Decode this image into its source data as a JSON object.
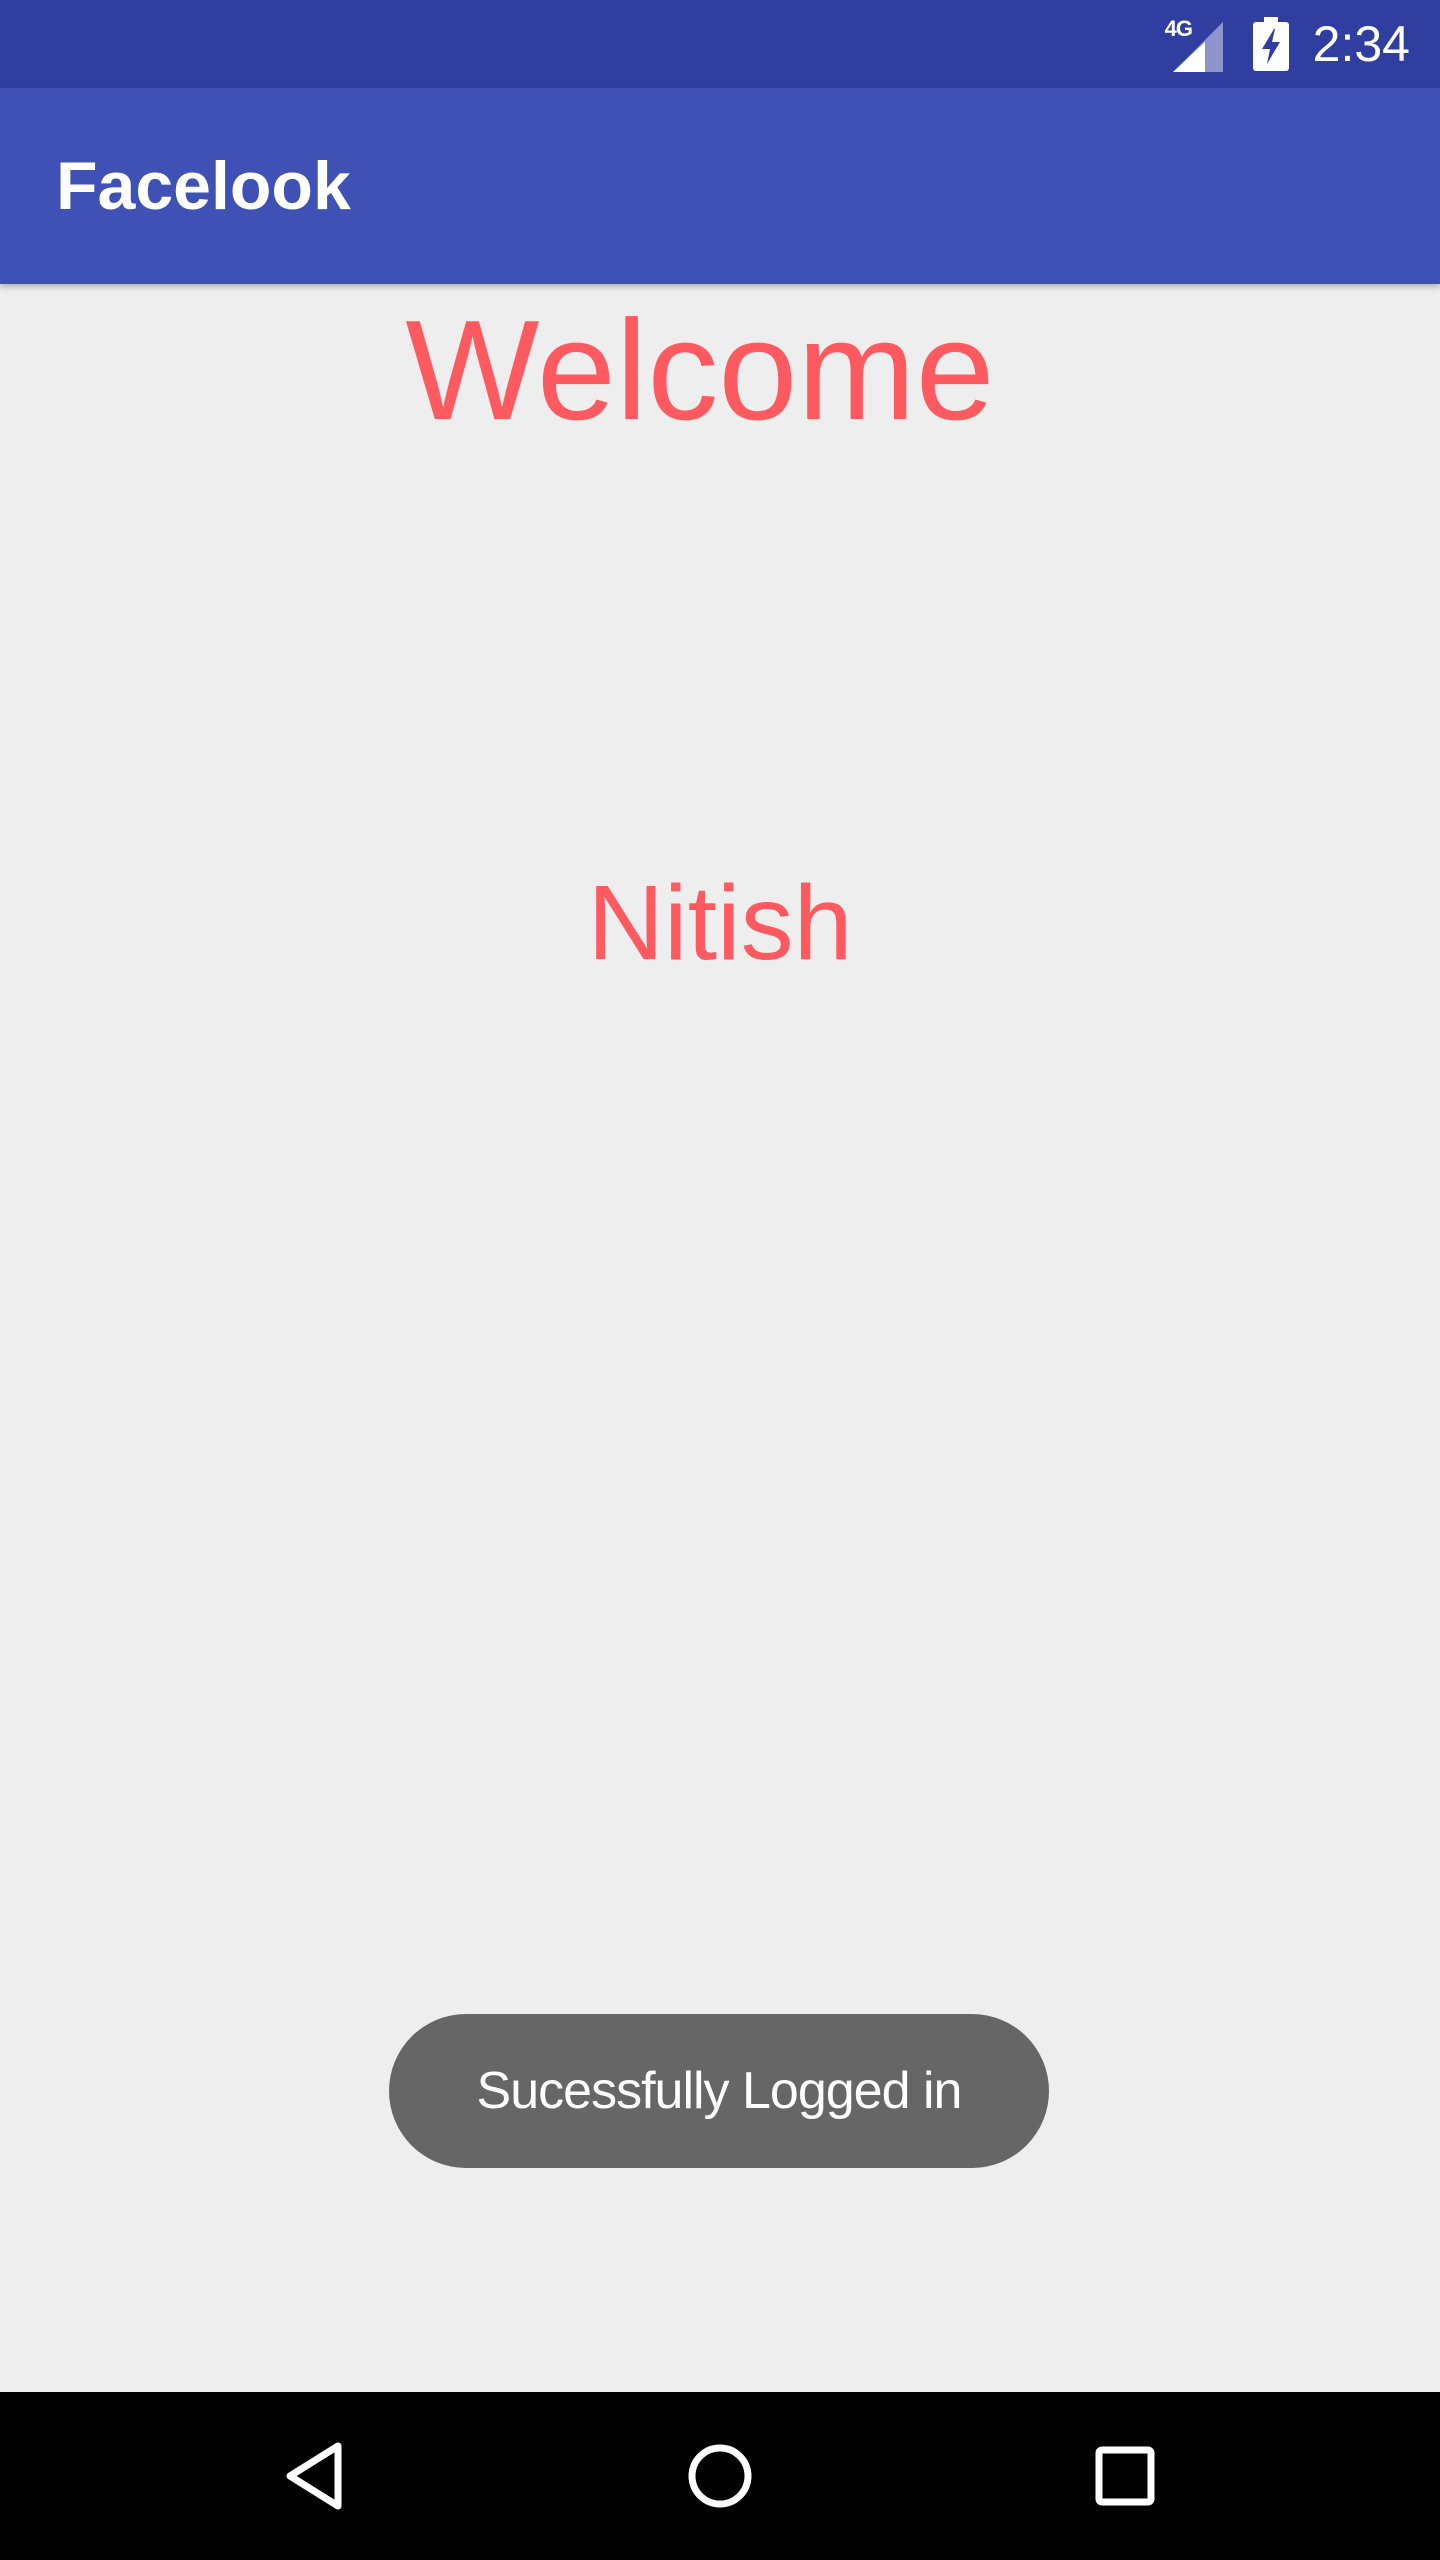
{
  "status_bar": {
    "network_label": "4G",
    "time": "2:34",
    "icons": [
      "signal-icon",
      "battery-charging-icon"
    ]
  },
  "app_bar": {
    "title": "Facelook"
  },
  "main": {
    "welcome_text": "Welcome",
    "user_name": "Nitish"
  },
  "toast": {
    "message": "Sucessfully Logged in"
  },
  "nav_bar": {
    "buttons": [
      "back-icon",
      "home-icon",
      "recents-icon"
    ]
  },
  "colors": {
    "status_bar": "#303f9f",
    "app_bar": "#3f51b5",
    "accent_text": "#ff5a5f",
    "background": "#eeeeee",
    "toast_background": "#666666"
  }
}
